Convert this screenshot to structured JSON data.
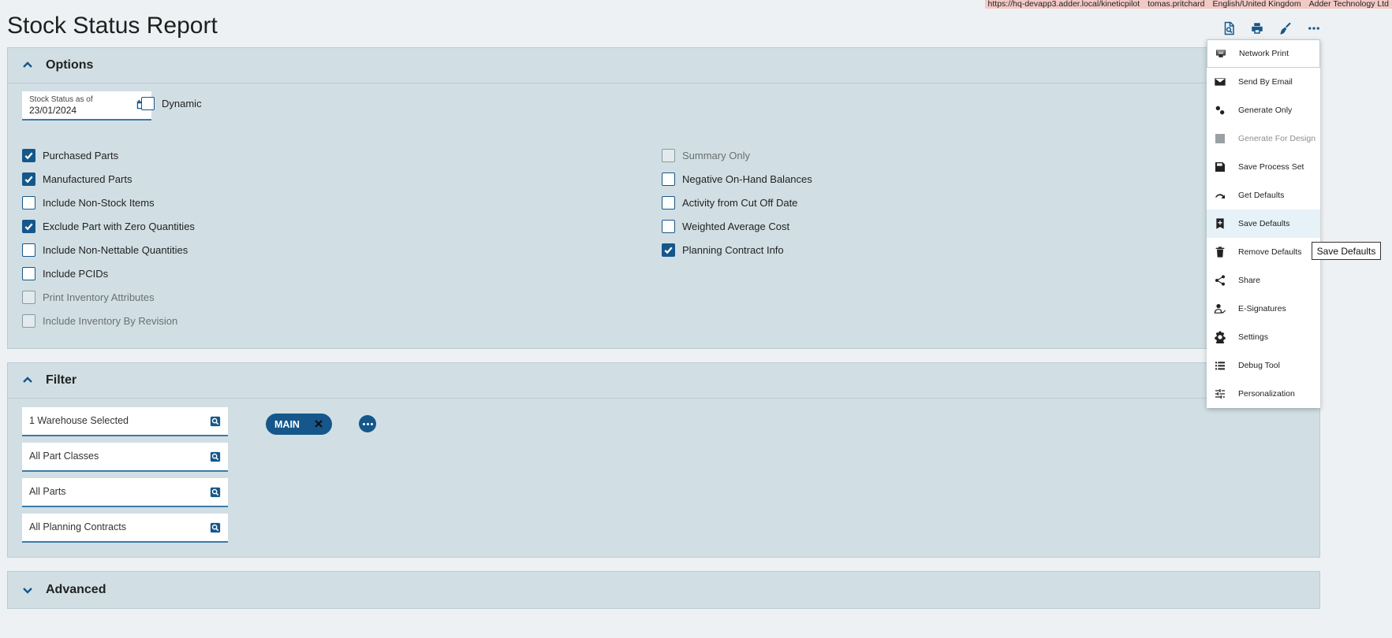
{
  "env": {
    "url": "https://hq-devapp3.adder.local/kineticpilot",
    "user": "tomas.pritchard",
    "language": "English/United Kingdom",
    "company": "Adder Technology Ltd"
  },
  "page": {
    "title": "Stock Status Report"
  },
  "toolbar": {
    "icons": [
      "preview-icon",
      "print-icon",
      "clear-icon",
      "more-icon"
    ]
  },
  "options": {
    "title": "Options",
    "date_label": "Stock Status as of",
    "date_value": "23/01/2024",
    "dynamic_label": "Dynamic",
    "dynamic_checked": false,
    "left_checks": [
      {
        "label": "Purchased Parts",
        "checked": true,
        "disabled": false
      },
      {
        "label": "Manufactured Parts",
        "checked": true,
        "disabled": false
      },
      {
        "label": "Include Non-Stock Items",
        "checked": false,
        "disabled": false
      },
      {
        "label": "Exclude Part with Zero Quantities",
        "checked": true,
        "disabled": false
      },
      {
        "label": "Include Non-Nettable Quantities",
        "checked": false,
        "disabled": false
      },
      {
        "label": "Include PCIDs",
        "checked": false,
        "disabled": false
      },
      {
        "label": "Print Inventory Attributes",
        "checked": false,
        "disabled": true
      },
      {
        "label": "Include Inventory By Revision",
        "checked": false,
        "disabled": true
      }
    ],
    "right_checks": [
      {
        "label": "Summary Only",
        "checked": false,
        "disabled": true
      },
      {
        "label": "Negative On-Hand Balances",
        "checked": false,
        "disabled": false
      },
      {
        "label": "Activity from Cut Off Date",
        "checked": false,
        "disabled": false
      },
      {
        "label": "Weighted Average Cost",
        "checked": false,
        "disabled": false
      },
      {
        "label": "Planning Contract Info",
        "checked": true,
        "disabled": false
      }
    ]
  },
  "filter": {
    "title": "Filter",
    "fields": [
      {
        "value": "1 Warehouse Selected"
      },
      {
        "value": "All Part Classes"
      },
      {
        "value": "All Parts"
      },
      {
        "value": "All Planning Contracts"
      }
    ],
    "chip": "MAIN"
  },
  "advanced": {
    "title": "Advanced"
  },
  "menu": {
    "items": [
      {
        "label": "Network Print",
        "icon": "network-print-icon",
        "disabled": false
      },
      {
        "label": "Send By Email",
        "icon": "email-icon",
        "disabled": false
      },
      {
        "label": "Generate Only",
        "icon": "generate-icon",
        "disabled": false
      },
      {
        "label": "Generate For Design",
        "icon": "design-icon",
        "disabled": true
      },
      {
        "label": "Save Process Set",
        "icon": "save-icon",
        "disabled": false
      },
      {
        "label": "Get Defaults",
        "icon": "redo-icon",
        "disabled": false
      },
      {
        "label": "Save Defaults",
        "icon": "bookmark-add-icon",
        "disabled": false
      },
      {
        "label": "Remove Defaults",
        "icon": "trash-icon",
        "disabled": false
      },
      {
        "label": "Share",
        "icon": "share-icon",
        "disabled": false
      },
      {
        "label": "E-Signatures",
        "icon": "esignature-icon",
        "disabled": false
      },
      {
        "label": "Settings",
        "icon": "gear-icon",
        "disabled": false
      },
      {
        "label": "Debug Tool",
        "icon": "list-icon",
        "disabled": false
      },
      {
        "label": "Personalization",
        "icon": "sliders-icon",
        "disabled": false
      }
    ]
  },
  "tooltip": "Save Defaults",
  "colors": {
    "accent": "#15578b",
    "panel": "#d1dfe4",
    "background": "#eef1f3",
    "env_bar": "#f3c9c4"
  }
}
